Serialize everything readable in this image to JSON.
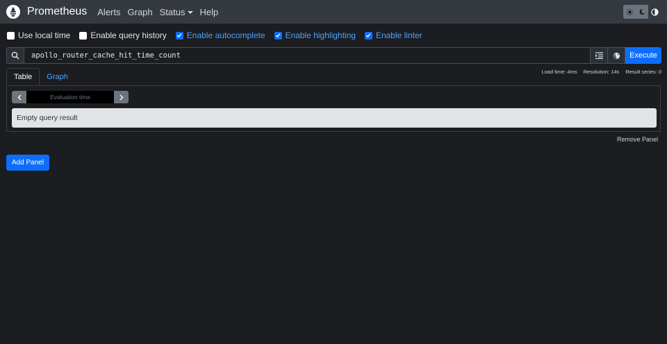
{
  "nav": {
    "brand": "Prometheus",
    "links": [
      "Alerts",
      "Graph",
      "Status",
      "Help"
    ]
  },
  "theme": {
    "icons": [
      "sun-icon",
      "moon-icon",
      "half-circle-icon"
    ],
    "active": "half-circle-icon"
  },
  "options": [
    {
      "label": "Use local time",
      "checked": false
    },
    {
      "label": "Enable query history",
      "checked": false
    },
    {
      "label": "Enable autocomplete",
      "checked": true
    },
    {
      "label": "Enable highlighting",
      "checked": true
    },
    {
      "label": "Enable linter",
      "checked": true
    }
  ],
  "query": {
    "value": "apollo_router_cache_hit_time_count",
    "execute_label": "Execute"
  },
  "stats": {
    "load_time": "Load time: 4ms",
    "resolution": "Resolution: 14s",
    "result_series": "Result series: 0"
  },
  "tabs": [
    {
      "label": "Table",
      "active": true
    },
    {
      "label": "Graph",
      "active": false
    }
  ],
  "evaluation": {
    "placeholder": "Evaluation time"
  },
  "result": {
    "message": "Empty query result"
  },
  "remove_panel_label": "Remove Panel",
  "add_panel_label": "Add Panel",
  "colors": {
    "accent": "#0d6efd",
    "navbar": "#343a40",
    "background": "#1b1d21"
  }
}
